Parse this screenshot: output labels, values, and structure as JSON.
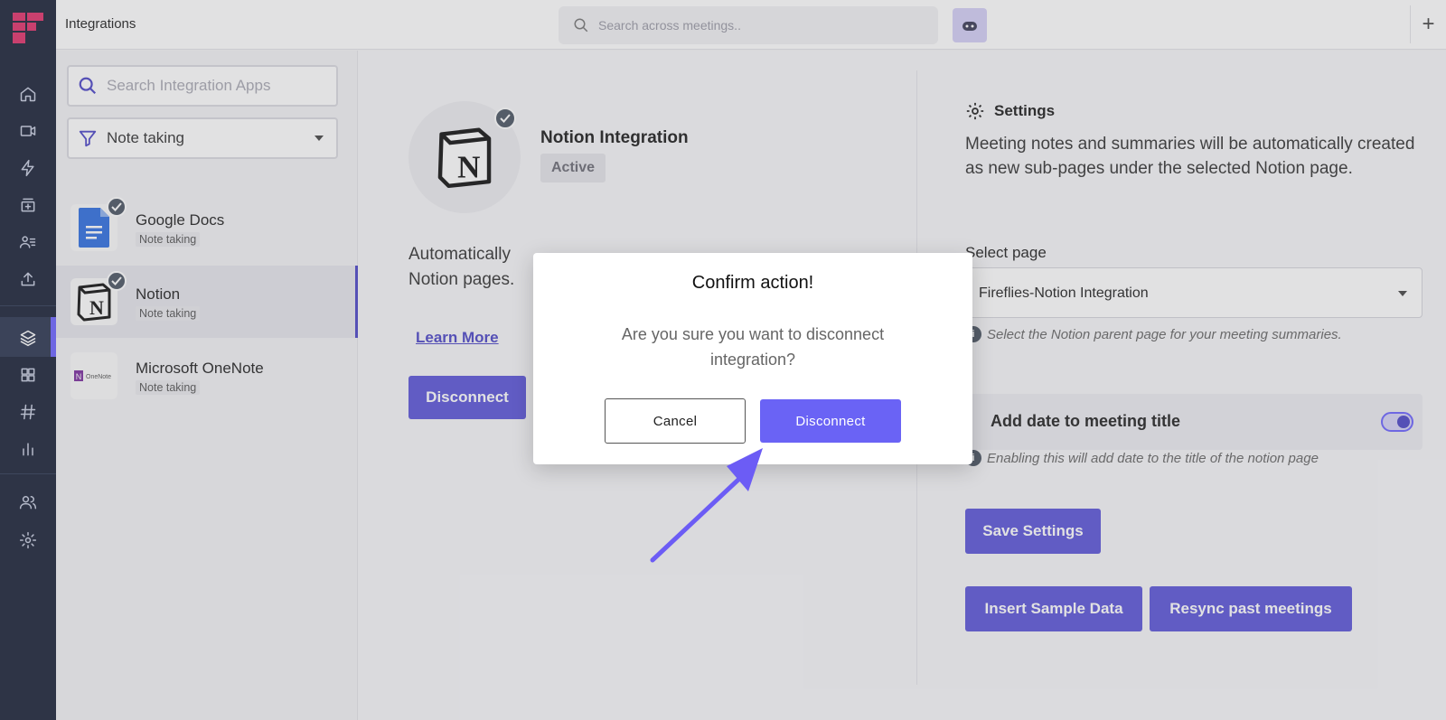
{
  "topbar": {
    "title": "Integrations",
    "search_placeholder": "Search across meetings.."
  },
  "rail": {
    "icons": [
      "home-icon",
      "video-icon",
      "bolt-icon",
      "inbox-icon",
      "contacts-icon",
      "upload-icon",
      "layers-icon",
      "grid-icon",
      "hashtag-icon",
      "chart-icon",
      "team-icon",
      "gear-icon"
    ]
  },
  "panel": {
    "search_placeholder": "Search Integration Apps",
    "filter_value": "Note taking",
    "items": [
      {
        "name": "Google Docs",
        "category": "Note taking",
        "connected": true
      },
      {
        "name": "Notion",
        "category": "Note taking",
        "connected": true,
        "selected": true
      },
      {
        "name": "Microsoft OneNote",
        "category": "Note taking",
        "connected": false
      }
    ]
  },
  "detail": {
    "title": "Notion Integration",
    "status": "Active",
    "description_line1": "Automatically",
    "description_line2": "Notion pages.",
    "learn_more": "Learn More",
    "disconnect": "Disconnect"
  },
  "settings": {
    "heading": "Settings",
    "description": "Meeting notes and summaries will be automatically created as new sub-pages under the selected Notion page.",
    "select_label": "Select page",
    "select_value": "Fireflies-Notion Integration",
    "select_hint": "Select the Notion parent page for your meeting summaries.",
    "toggle_label": "Add date to meeting title",
    "toggle_on": true,
    "toggle_hint": "Enabling this will add date to the title of the notion page",
    "save_button": "Save Settings",
    "insert_button": "Insert Sample Data",
    "resync_button": "Resync past meetings"
  },
  "dialog": {
    "title": "Confirm action!",
    "message": "Are you sure you want to disconnect integration?",
    "cancel": "Cancel",
    "confirm": "Disconnect"
  },
  "colors": {
    "accent": "#5b55d9",
    "rail": "#1a2238",
    "arrow": "#6c5cf5"
  }
}
